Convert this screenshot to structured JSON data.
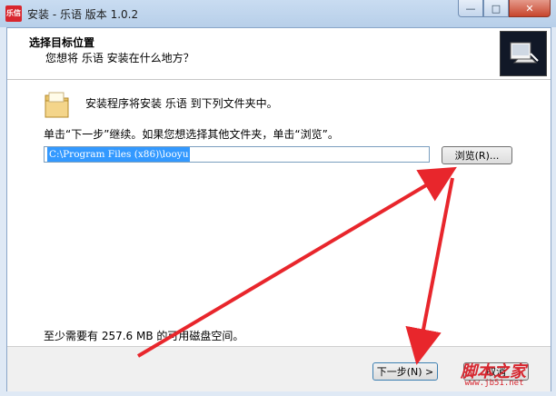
{
  "window": {
    "title": "安装 - 乐语 版本 1.0.2",
    "app_icon_text": "乐信",
    "minimize": "—",
    "maximize": "□",
    "close": "✕"
  },
  "header": {
    "title": "选择目标位置",
    "subtitle": "您想将 乐语 安装在什么地方？"
  },
  "body": {
    "install_text": "安装程序将安装 乐语 到下列文件夹中。",
    "instruction": "单击“下一步”继续。如果您想选择其他文件夹，单击“浏览”。",
    "path_value": "C:\\Program Files (x86)\\looyu",
    "browse_label": "浏览(R)...",
    "space_text": "至少需要有 257.6 MB 的可用磁盘空间。"
  },
  "footer": {
    "next_label": "下一步(N) >",
    "cancel_label": "取消"
  },
  "watermark": {
    "text": "脚本之家",
    "url": "www.jb51.net"
  },
  "colors": {
    "annotation_arrow": "#e8262c",
    "selection": "#3399ff"
  }
}
